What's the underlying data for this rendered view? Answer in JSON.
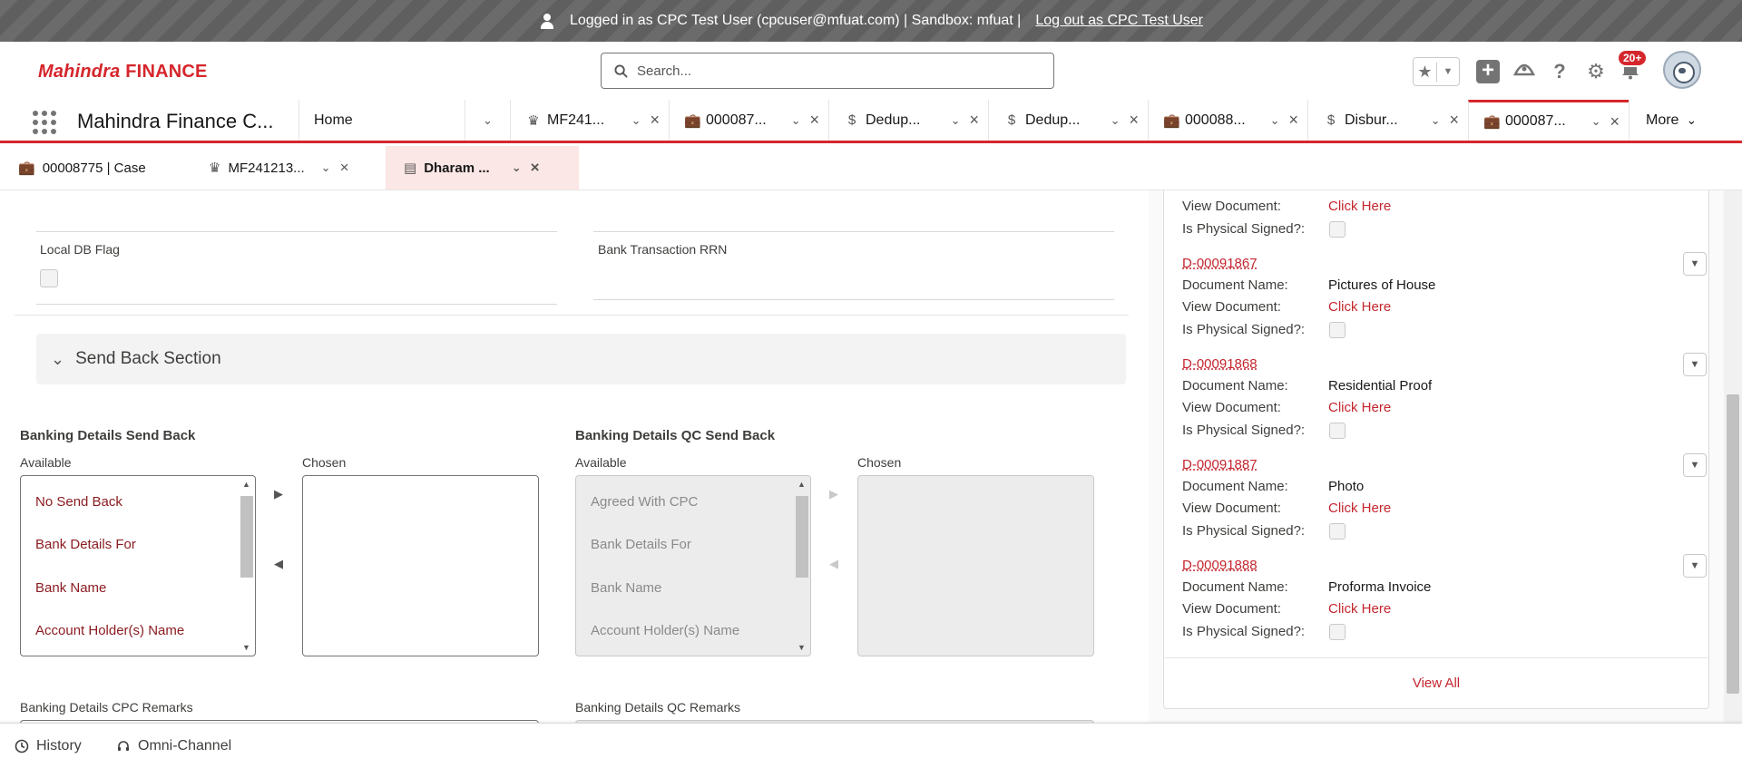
{
  "impersonation": {
    "message": "Logged in as CPC Test User (cpcuser@mfuat.com) | Sandbox: mfuat |",
    "logout_label": "Log out as CPC Test User"
  },
  "brand": {
    "logo_text_1": "Mahindra",
    "logo_text_2": "FINANCE",
    "color": "#d5262c"
  },
  "search": {
    "placeholder": "Search..."
  },
  "header": {
    "notification_count": "20+"
  },
  "app": {
    "name": "Mahindra Finance C..."
  },
  "primary_tabs": [
    {
      "label": "Home",
      "icon": "home"
    },
    {
      "label": "MF241...",
      "icon": "crown-icon"
    },
    {
      "label": "000087...",
      "icon": "briefcase-icon"
    },
    {
      "label": "Dedup...",
      "icon": "money-bag-icon"
    },
    {
      "label": "Dedup...",
      "icon": "money-bag-icon"
    },
    {
      "label": "000088...",
      "icon": "briefcase-icon"
    },
    {
      "label": "Disbur...",
      "icon": "money-bag-icon"
    },
    {
      "label": "000087...",
      "icon": "briefcase-icon",
      "active": true
    }
  ],
  "more_label": "More",
  "sub_tabs": [
    {
      "label": "00008775 | Case",
      "icon": "briefcase-icon"
    },
    {
      "label": "MF241213...",
      "icon": "crown-icon"
    },
    {
      "label": "Dharam ...",
      "icon": "record-icon",
      "active": true
    }
  ],
  "form": {
    "local_db_flag_label": "Local DB Flag",
    "bank_rrn_label": "Bank Transaction RRN",
    "section_title": "Send Back Section",
    "banking_send_back": {
      "title": "Banking Details Send Back",
      "available_label": "Available",
      "chosen_label": "Chosen",
      "options": [
        "No Send Back",
        "Bank Details For",
        "Bank Name",
        "Account Holder(s) Name"
      ]
    },
    "banking_qc_send_back": {
      "title": "Banking Details QC Send Back",
      "available_label": "Available",
      "chosen_label": "Chosen",
      "options": [
        "Agreed With CPC",
        "Bank Details For",
        "Bank Name",
        "Account Holder(s) Name"
      ]
    },
    "cpc_remarks_label": "Banking Details CPC Remarks",
    "qc_remarks_label": "Banking Details QC Remarks"
  },
  "documents": {
    "key_view": "View Document:",
    "key_name": "Document Name:",
    "key_signed": "Is Physical Signed?:",
    "click_here": "Click Here",
    "items": [
      {
        "id": "D-00091867",
        "name": "Pictures of House"
      },
      {
        "id": "D-00091868",
        "name": "Residential Proof"
      },
      {
        "id": "D-00091887",
        "name": "Photo"
      },
      {
        "id": "D-00091888",
        "name": "Proforma Invoice"
      }
    ],
    "view_all": "View All"
  },
  "utility_bar": {
    "history": "History",
    "omni": "Omni-Channel"
  }
}
